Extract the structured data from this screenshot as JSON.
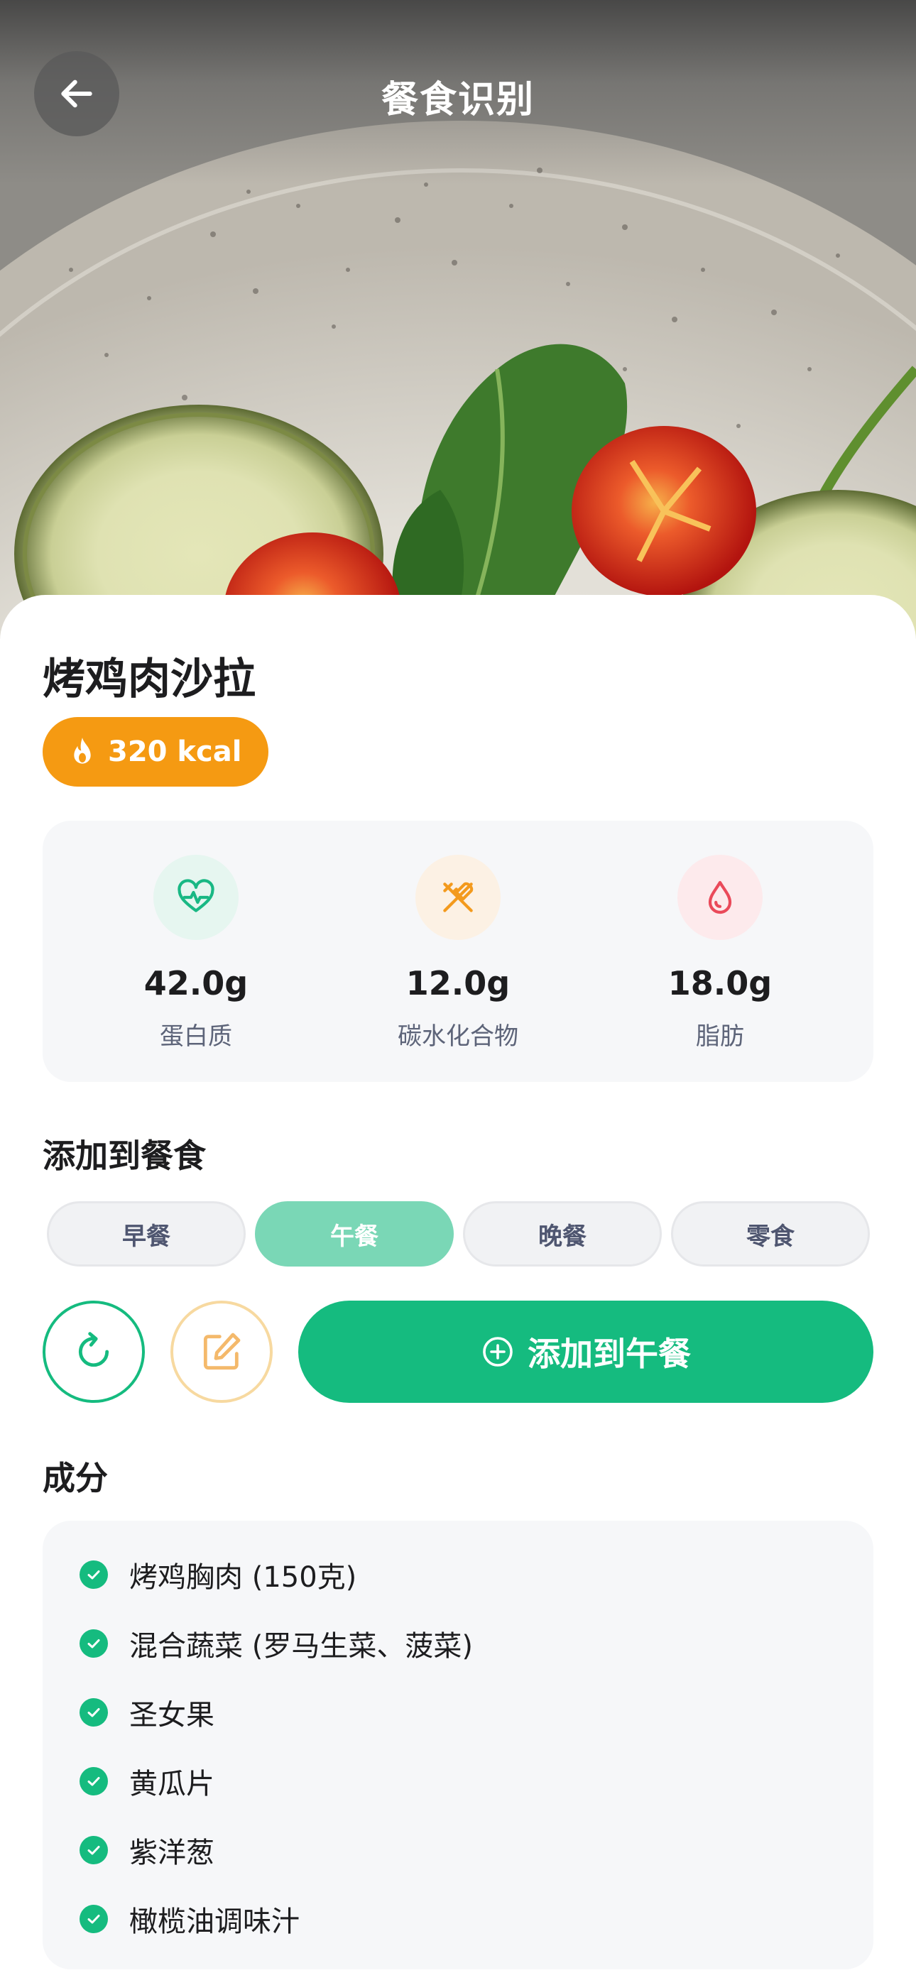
{
  "header": {
    "title": "餐食识别",
    "back_icon": "arrow-left-icon"
  },
  "meal": {
    "name": "烤鸡肉沙拉",
    "calories": "320 kcal",
    "calories_icon": "flame-icon"
  },
  "macros": [
    {
      "value": "42.0g",
      "label": "蛋白质",
      "icon": "heart-pulse-icon",
      "color": "#19b884",
      "bg": "#e6f6f0"
    },
    {
      "value": "12.0g",
      "label": "碳水化合物",
      "icon": "utensils-icon",
      "color": "#f39a1d",
      "bg": "#fcf1e4"
    },
    {
      "value": "18.0g",
      "label": "脂肪",
      "icon": "droplet-icon",
      "color": "#ea4a5a",
      "bg": "#fdeaec"
    }
  ],
  "add_section": {
    "title": "添加到餐食",
    "tabs": [
      "早餐",
      "午餐",
      "晚餐",
      "零食"
    ],
    "selected": "午餐"
  },
  "actions": {
    "retake_icon": "refresh-icon",
    "edit_icon": "edit-icon",
    "add_label": "添加到午餐",
    "add_icon": "plus-circle-icon"
  },
  "ingredients": {
    "title": "成分",
    "items": [
      "烤鸡胸肉 (150克)",
      "混合蔬菜 (罗马生菜、菠菜)",
      "圣女果",
      "黄瓜片",
      "紫洋葱",
      "橄榄油调味汁"
    ]
  },
  "colors": {
    "primary": "#15bb7f",
    "accent_orange": "#f59a12",
    "selected_tab": "#7ad7b6"
  }
}
